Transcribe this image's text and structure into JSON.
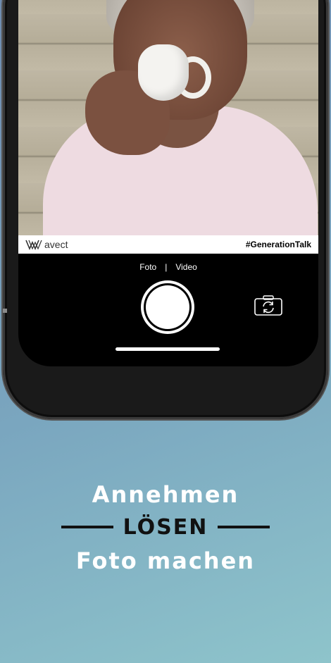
{
  "watermark": {
    "logo_text": "avect",
    "hashtag": "#GenerationTalk"
  },
  "camera": {
    "modes": [
      "Foto",
      "Video"
    ],
    "separator": "|",
    "flip_icon": "camera-flip-icon"
  },
  "headline": {
    "line1": "Annehmen",
    "line2": "LÖSEN",
    "line3": "Foto machen"
  },
  "colors": {
    "background_top": "#6f8cb0",
    "background_bottom": "#8ec4cb",
    "accent_dark": "#111111"
  }
}
